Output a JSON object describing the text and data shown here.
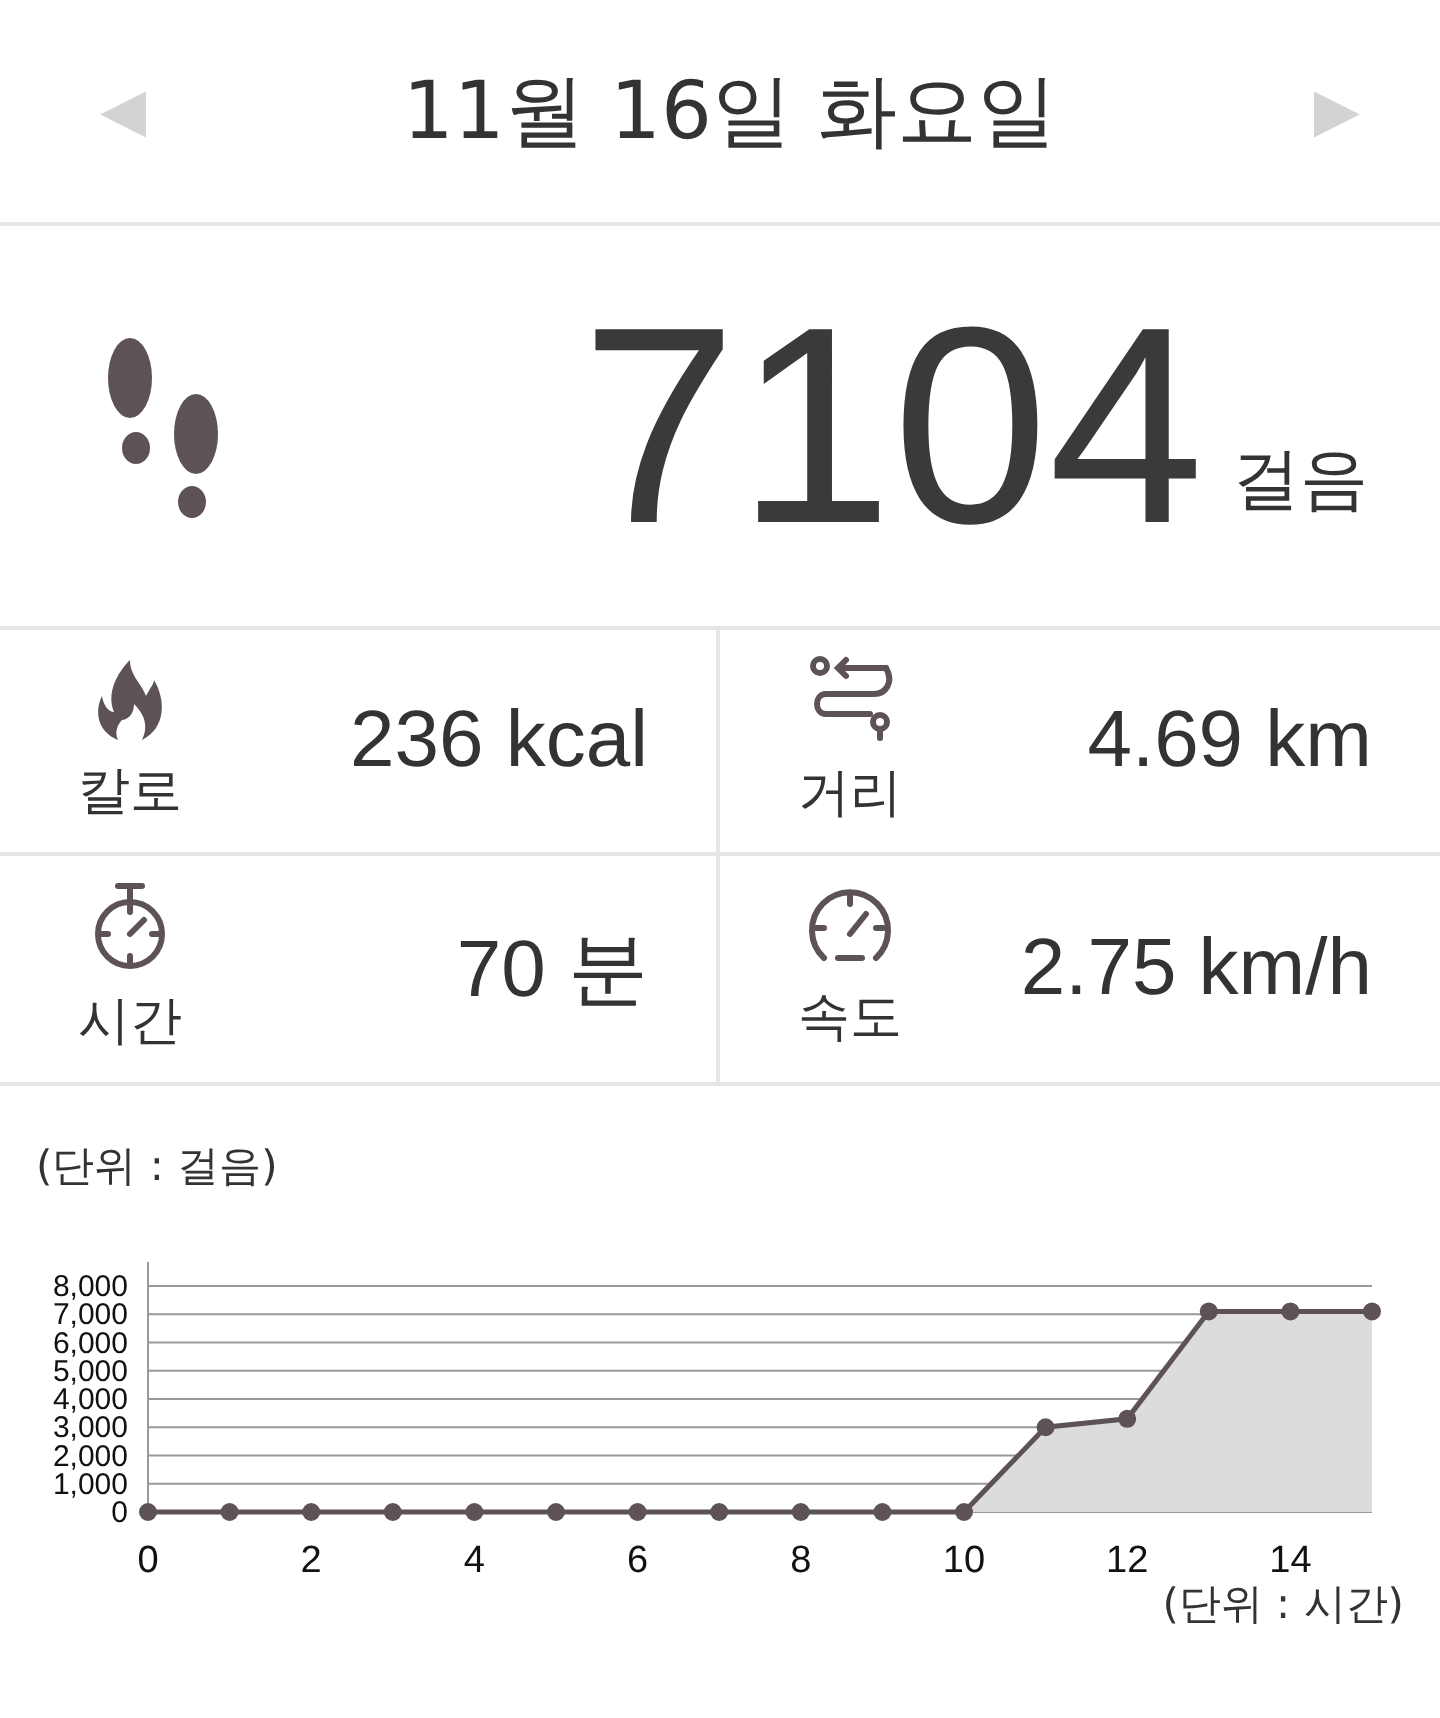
{
  "header": {
    "prev": "◀",
    "title": "11월 16일 화요일",
    "next": "▶"
  },
  "steps": {
    "value": "7104",
    "unit": "걸음"
  },
  "stats": [
    {
      "kind": "flame",
      "label": "칼로",
      "value": "236 kcal"
    },
    {
      "kind": "route",
      "label": "거리",
      "value": "4.69 km"
    },
    {
      "kind": "stopwatch",
      "label": "시간",
      "value": "70 분"
    },
    {
      "kind": "speedometer",
      "label": "속도",
      "value": "2.75 km/h"
    }
  ],
  "chart": {
    "unit_label": "(단위 : 걸음)",
    "x_unit_label": "(단위 : 시간)",
    "chart_data": {
      "type": "area",
      "x": [
        0,
        1,
        2,
        3,
        4,
        5,
        6,
        7,
        8,
        9,
        10,
        11,
        12,
        13,
        14,
        15
      ],
      "series": [
        {
          "color": "#5e5354",
          "values": [
            0,
            0,
            0,
            0,
            0,
            0,
            0,
            0,
            0,
            0,
            0,
            3000,
            3300,
            7100,
            7100,
            7100
          ]
        }
      ],
      "grid": true,
      "xlim": [
        0,
        15
      ],
      "ylim": [
        0,
        8000
      ],
      "xticks": [
        0,
        2,
        4,
        6,
        8,
        10,
        12,
        14
      ],
      "yticks": [
        0,
        {
          "value": 1000,
          "label": "1,000"
        },
        {
          "value": 2000,
          "label": "2,000"
        },
        {
          "value": 3000,
          "label": "3,000"
        },
        {
          "value": 4000,
          "label": "4,000"
        },
        {
          "value": 5000,
          "label": "5,000"
        },
        {
          "value": 6000,
          "label": "6,000"
        },
        {
          "value": 7000,
          "label": "7,000"
        },
        {
          "value": 8000,
          "label": "8,000"
        }
      ]
    }
  }
}
